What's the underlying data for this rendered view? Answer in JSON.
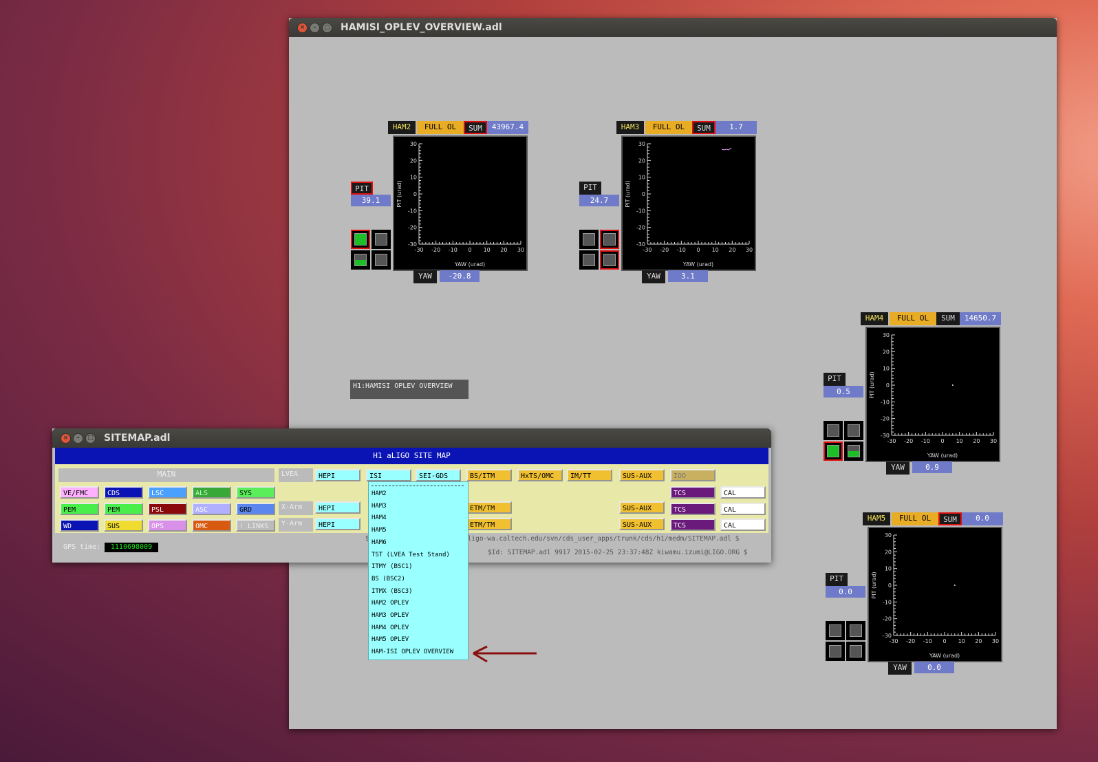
{
  "overview_window": {
    "title": "HAMISI_OPLEV_OVERVIEW.adl",
    "window_label": "H1:HAMISI OPLEV OVERVIEW"
  },
  "panels": {
    "ham2": {
      "name": "HAM2",
      "mode": "FULL OL",
      "sum_label": "SUM",
      "sum": "43967.4",
      "pit_label": "PIT",
      "pit": "39.1",
      "yaw_label": "YAW",
      "yaw": "-20.8"
    },
    "ham3": {
      "name": "HAM3",
      "mode": "FULL OL",
      "sum_label": "SUM",
      "sum": "1.7",
      "pit_label": "PIT",
      "pit": "24.7",
      "yaw_label": "YAW",
      "yaw": "3.1"
    },
    "ham4": {
      "name": "HAM4",
      "mode": "FULL OL",
      "sum_label": "SUM",
      "sum": "14650.7",
      "pit_label": "PIT",
      "pit": "0.5",
      "yaw_label": "YAW",
      "yaw": "0.9"
    },
    "ham5": {
      "name": "HAM5",
      "mode": "FULL OL",
      "sum_label": "SUM",
      "sum": "0.0",
      "pit_label": "PIT",
      "pit": "0.0",
      "yaw_label": "YAW",
      "yaw": "0.0"
    }
  },
  "plot": {
    "xlabel": "YAW (urad)",
    "ylabel": "PIT (urad)",
    "ticks": [
      "30",
      "20",
      "10",
      "0",
      "-10",
      "-20",
      "-30"
    ],
    "xticks": [
      "-30",
      "-20",
      "-10",
      "0",
      "10",
      "20",
      "30"
    ]
  },
  "sitemap": {
    "title": "SITEMAP.adl",
    "header": "H1 aLIGO SITE MAP",
    "main_label": "MAIN",
    "gps_label": "GPS time:",
    "gps_value": "1110698009",
    "svn_path": "$HeadURL: https://redoubt.ligo-wa.caltech.edu/svn/cds_user_apps/trunk/cds/h1/medm/SITEMAP.adl $",
    "svn_id": "$Id: SITEMAP.adl 9917 2015-02-25 23:37:48Z kiwamu.izumi@LIGO.ORG $",
    "main_rows": [
      [
        "VE/FMC",
        "CDS",
        "LSC",
        "ALS",
        "SYS"
      ],
      [
        "PEM",
        "PEM",
        "PSL",
        "ASC",
        "GRD"
      ],
      [
        "WD",
        "SUS",
        "OPS",
        "OMC",
        "! LINKS"
      ]
    ],
    "row_labels": [
      "LVEA",
      "X-Arm",
      "Y-Arm"
    ],
    "lvea_buttons": [
      "HEPI",
      "ISI",
      "SEI-GDS",
      "BS/ITM",
      "HxTS/OMC",
      "IM/TT",
      "SUS-AUX",
      "IOO"
    ],
    "tcs": "TCS",
    "cal": "CAL",
    "hepi": "HEPI",
    "etm": "ETM/TM",
    "sus_aux": "SUS-AUX"
  },
  "dropdown": {
    "items": [
      "HAM2",
      "HAM3",
      "HAM4",
      "HAM5",
      "HAM6",
      "TST (LVEA Test Stand)",
      "ITMY (BSC1)",
      "BS (BSC2)",
      "ITMX (BSC3)",
      "HAM2 OPLEV",
      "HAM3 OPLEV",
      "HAM4 OPLEV",
      "HAM5 OPLEV",
      "HAM-ISI OPLEV OVERVIEW"
    ]
  },
  "colors": {
    "medm_gray": "#bbbbbb",
    "title_blue": "#0a14b4",
    "arrow": "#8a1010"
  }
}
